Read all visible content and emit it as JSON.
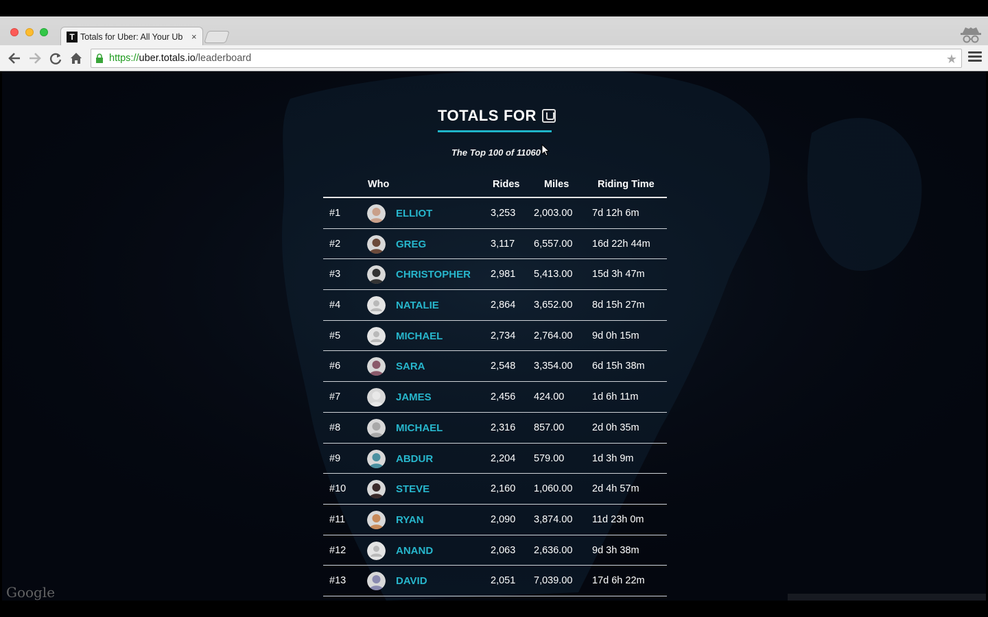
{
  "browser": {
    "tab_title": "Totals for Uber: All Your Ub",
    "tab_close": "×",
    "favicon_letter": "T",
    "url": {
      "protocol": "https://",
      "host": "uber.totals.io",
      "path": "/leaderboard"
    },
    "icons": [
      "back-icon",
      "forward-icon",
      "reload-icon",
      "home-icon",
      "lock-icon",
      "star-icon",
      "menu-icon",
      "incognito-icon"
    ]
  },
  "page": {
    "logo": {
      "bold": "TOTALS",
      "light": "FOR"
    },
    "subtitle": "The Top 100 of 11060",
    "accent_color": "#1fb5c9",
    "headers": {
      "who": "Who",
      "rides": "Rides",
      "miles": "Miles",
      "time": "Riding Time"
    },
    "rows": [
      {
        "rank": "#1",
        "name": "ELLIOT",
        "rides": "3,253",
        "miles": "2,003.00",
        "time": "7d 12h 6m",
        "avatar": "photo"
      },
      {
        "rank": "#2",
        "name": "GREG",
        "rides": "3,117",
        "miles": "6,557.00",
        "time": "16d 22h 44m",
        "avatar": "photo"
      },
      {
        "rank": "#3",
        "name": "CHRISTOPHER",
        "rides": "2,981",
        "miles": "5,413.00",
        "time": "15d 3h 47m",
        "avatar": "photo"
      },
      {
        "rank": "#4",
        "name": "NATALIE",
        "rides": "2,864",
        "miles": "3,652.00",
        "time": "8d 15h 27m",
        "avatar": "default"
      },
      {
        "rank": "#5",
        "name": "MICHAEL",
        "rides": "2,734",
        "miles": "2,764.00",
        "time": "9d 0h 15m",
        "avatar": "default"
      },
      {
        "rank": "#6",
        "name": "SARA",
        "rides": "2,548",
        "miles": "3,354.00",
        "time": "6d 15h 38m",
        "avatar": "photo"
      },
      {
        "rank": "#7",
        "name": "JAMES",
        "rides": "2,456",
        "miles": "424.00",
        "time": "1d 6h 11m",
        "avatar": "photo"
      },
      {
        "rank": "#8",
        "name": "MICHAEL",
        "rides": "2,316",
        "miles": "857.00",
        "time": "2d 0h 35m",
        "avatar": "photo"
      },
      {
        "rank": "#9",
        "name": "ABDUR",
        "rides": "2,204",
        "miles": "579.00",
        "time": "1d 3h 9m",
        "avatar": "photo"
      },
      {
        "rank": "#10",
        "name": "STEVE",
        "rides": "2,160",
        "miles": "1,060.00",
        "time": "2d 4h 57m",
        "avatar": "photo"
      },
      {
        "rank": "#11",
        "name": "RYAN",
        "rides": "2,090",
        "miles": "3,874.00",
        "time": "11d 23h 0m",
        "avatar": "photo"
      },
      {
        "rank": "#12",
        "name": "ANAND",
        "rides": "2,063",
        "miles": "2,636.00",
        "time": "9d 3h 38m",
        "avatar": "default"
      },
      {
        "rank": "#13",
        "name": "DAVID",
        "rides": "2,051",
        "miles": "7,039.00",
        "time": "17d 6h 22m",
        "avatar": "photo"
      }
    ],
    "map_attribution": "Google"
  }
}
